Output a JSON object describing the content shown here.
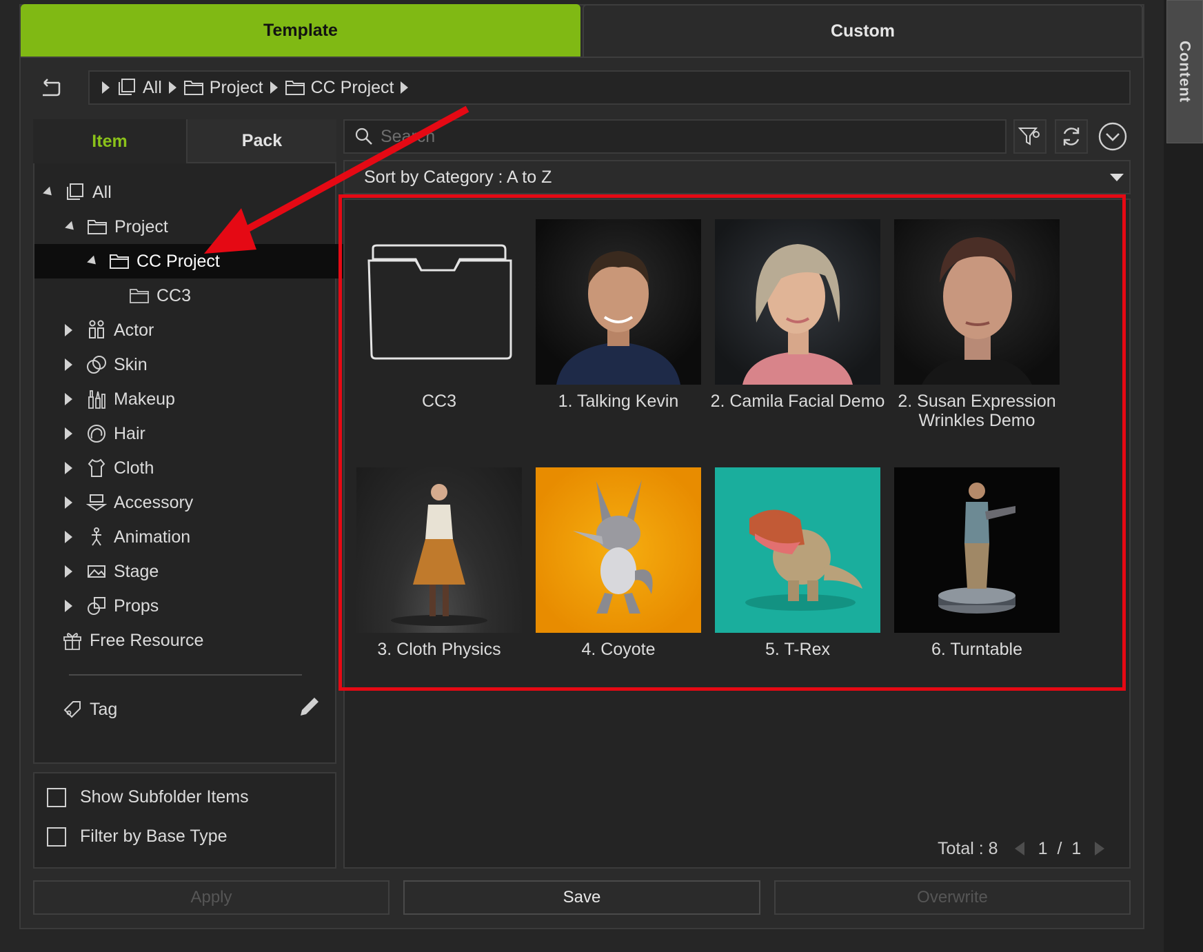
{
  "top_tabs": {
    "template": "Template",
    "custom": "Custom"
  },
  "side_tab": "Content",
  "breadcrumb": [
    "All",
    "Project",
    "CC Project"
  ],
  "sub_tabs": {
    "item": "Item",
    "pack": "Pack"
  },
  "tree": {
    "all": "All",
    "project": "Project",
    "cc_project": "CC Project",
    "cc3": "CC3",
    "actor": "Actor",
    "skin": "Skin",
    "makeup": "Makeup",
    "hair": "Hair",
    "cloth": "Cloth",
    "accessory": "Accessory",
    "animation": "Animation",
    "stage": "Stage",
    "props": "Props",
    "free_resource": "Free Resource",
    "tag": "Tag"
  },
  "options": {
    "show_subfolder": "Show Subfolder Items",
    "filter_base": "Filter by Base Type"
  },
  "search": {
    "placeholder": "Search"
  },
  "sort": "Sort by Category : A to Z",
  "items": [
    {
      "label": "CC3",
      "kind": "folder"
    },
    {
      "label": "1. Talking Kevin"
    },
    {
      "label": "2. Camila Facial Demo"
    },
    {
      "label": "2. Susan Expression Wrinkles Demo"
    },
    {
      "label": "3. Cloth Physics"
    },
    {
      "label": "4. Coyote"
    },
    {
      "label": "5. T-Rex"
    },
    {
      "label": "6. Turntable"
    }
  ],
  "footer": {
    "total": "Total : 8",
    "page": "1",
    "slash": "/",
    "pages": "1"
  },
  "buttons": {
    "apply": "Apply",
    "save": "Save",
    "overwrite": "Overwrite"
  },
  "colors": {
    "accent": "#80b914",
    "highlight": "#e50914",
    "background": "#262626"
  }
}
